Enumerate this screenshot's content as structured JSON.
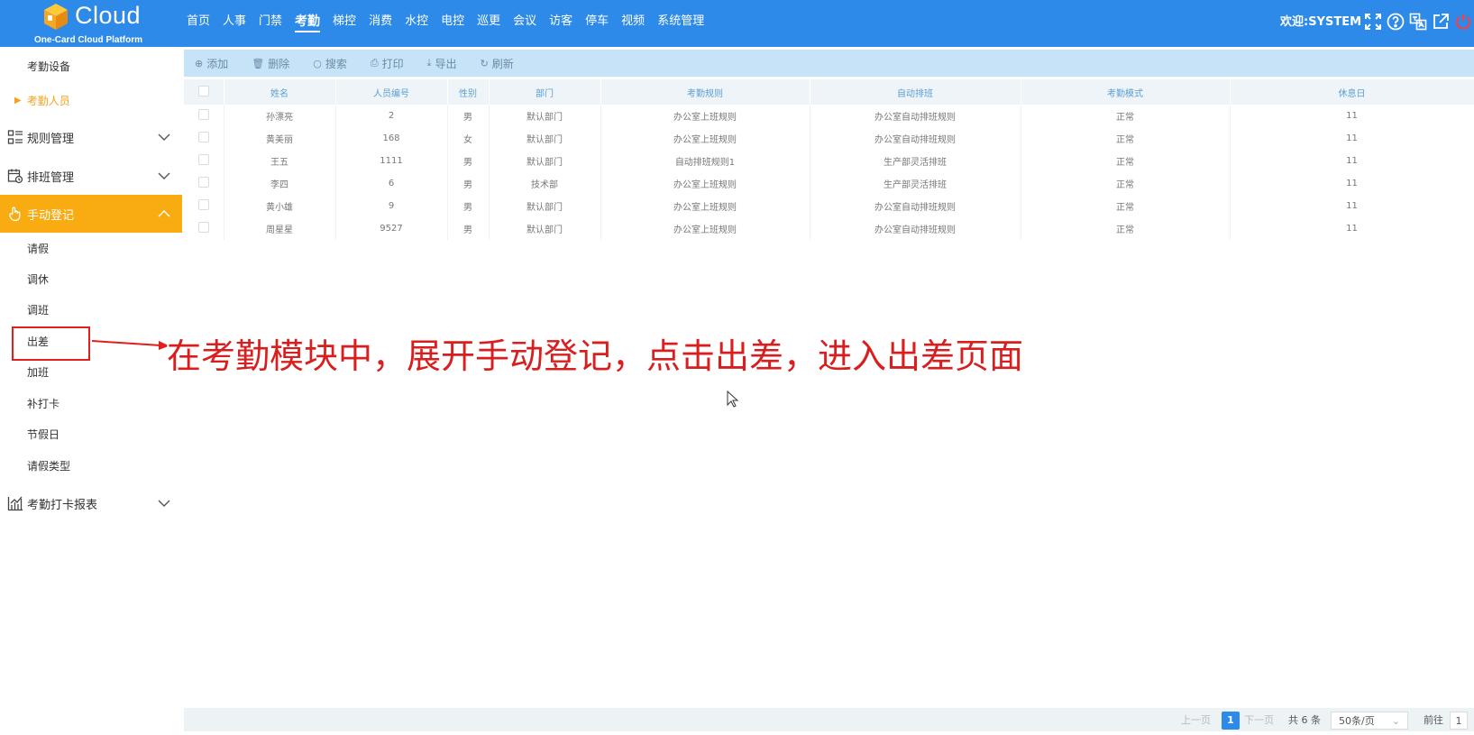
{
  "logo": {
    "text": "Cloud",
    "subtitle": "One-Card Cloud Platform"
  },
  "nav": {
    "items": [
      "首页",
      "人事",
      "门禁",
      "考勤",
      "梯控",
      "消费",
      "水控",
      "电控",
      "巡更",
      "会议",
      "访客",
      "停车",
      "视频",
      "系统管理"
    ],
    "active": "考勤"
  },
  "header": {
    "welcome": "欢迎:SYSTEM"
  },
  "sidebar": {
    "kq_device": "考勤设备",
    "kq_person": "考勤人员",
    "rule_manage": "规则管理",
    "shift_manage": "排班管理",
    "manual_register": "手动登记",
    "leave": "请假",
    "rest_adjust": "调休",
    "shift_adjust": "调班",
    "business_trip": "出差",
    "overtime": "加班",
    "card_patch": "补打卡",
    "holiday": "节假日",
    "leave_type": "请假类型",
    "kq_report": "考勤打卡报表"
  },
  "toolbar": {
    "add": "添加",
    "delete": "删除",
    "search": "搜索",
    "print": "打印",
    "export": "导出",
    "refresh": "刷新"
  },
  "table": {
    "headers": [
      "姓名",
      "人员编号",
      "性别",
      "部门",
      "考勤规则",
      "自动排班",
      "考勤模式",
      "休息日"
    ],
    "rows": [
      [
        "孙漂亮",
        "2",
        "男",
        "默认部门",
        "办公室上班规则",
        "办公室自动排班规则",
        "正常",
        "11"
      ],
      [
        "黄美丽",
        "168",
        "女",
        "默认部门",
        "办公室上班规则",
        "办公室自动排班规则",
        "正常",
        "11"
      ],
      [
        "王五",
        "1111",
        "男",
        "默认部门",
        "自动排班规则1",
        "生产部灵活排班",
        "正常",
        "11"
      ],
      [
        "李四",
        "6",
        "男",
        "技术部",
        "办公室上班规则",
        "生产部灵活排班",
        "正常",
        "11"
      ],
      [
        "黄小雄",
        "9",
        "男",
        "默认部门",
        "办公室上班规则",
        "办公室自动排班规则",
        "正常",
        "11"
      ],
      [
        "周星星",
        "9527",
        "男",
        "默认部门",
        "办公室上班规则",
        "办公室自动排班规则",
        "正常",
        "11"
      ]
    ]
  },
  "pager": {
    "prev": "上一页",
    "current": "1",
    "next": "下一页",
    "total": "共 6 条",
    "page_size": "50条/页",
    "goto": "前往",
    "goto_value": "1"
  },
  "annotation": {
    "text": "在考勤模块中，展开手动登记，点击出差，进入出差页面"
  },
  "colors": {
    "primary": "#2d8ae8",
    "sidebar_active": "#f8ac12",
    "annotation": "#d81e1e"
  }
}
